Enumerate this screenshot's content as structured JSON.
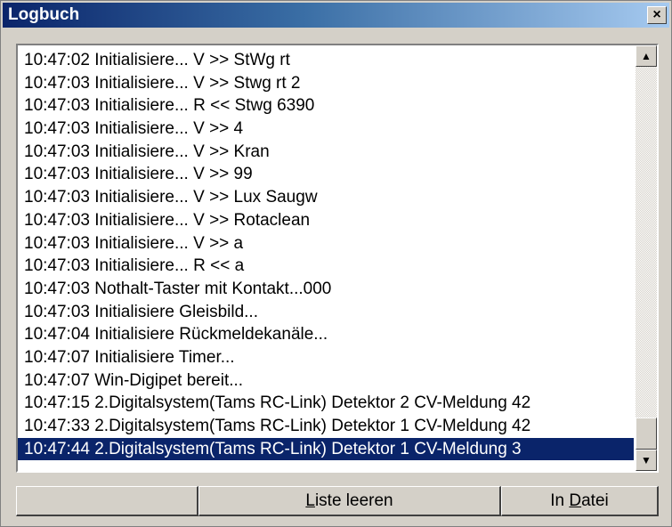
{
  "window": {
    "title": "Logbuch",
    "close_label": "×"
  },
  "log": {
    "entries": [
      "10:47:02 Initialisiere... V >> StWg rt",
      "10:47:03 Initialisiere... V >> Stwg rt 2",
      "10:47:03 Initialisiere... R << Stwg 6390",
      "10:47:03 Initialisiere... V >> 4",
      "10:47:03 Initialisiere... V >> Kran",
      "10:47:03 Initialisiere... V >> 99",
      "10:47:03 Initialisiere... V >> Lux Saugw",
      "10:47:03 Initialisiere... V >> Rotaclean",
      "10:47:03 Initialisiere... V >> a",
      "10:47:03 Initialisiere... R << a",
      "10:47:03 Nothalt-Taster mit Kontakt...000",
      "10:47:03 Initialisiere Gleisbild...",
      "10:47:04 Initialisiere Rückmeldekanäle...",
      "10:47:07 Initialisiere Timer...",
      "10:47:07 Win-Digipet bereit...",
      "10:47:15 2.Digitalsystem(Tams RC-Link) Detektor 2 CV-Meldung 42",
      "10:47:33 2.Digitalsystem(Tams RC-Link) Detektor 1 CV-Meldung 42",
      "10:47:44 2.Digitalsystem(Tams RC-Link) Detektor 1 CV-Meldung 3"
    ],
    "selected_index": 17
  },
  "scrollbar": {
    "up_arrow": "▲",
    "down_arrow": "▼"
  },
  "buttons": {
    "clear": {
      "mnemonic": "L",
      "rest": "iste leeren"
    },
    "file": {
      "prefix": "In ",
      "mnemonic": "D",
      "rest": "atei"
    }
  }
}
